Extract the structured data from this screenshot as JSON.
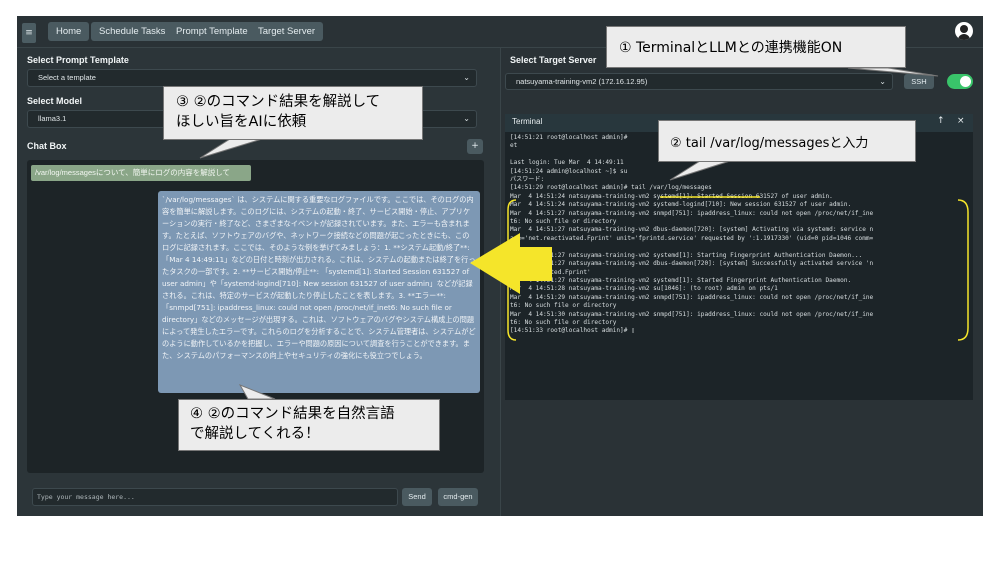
{
  "nav": {
    "menu_icon": "menu-icon",
    "items": [
      "Home",
      "Schedule Tasks",
      "Prompt Template",
      "Target Server"
    ],
    "avatar_icon": "user-avatar-icon"
  },
  "left": {
    "prompt_label": "Select Prompt Template",
    "prompt_value": "Select a template",
    "model_label": "Select Model",
    "model_value": "llama3.1",
    "chat_label": "Chat Box",
    "plus": "+",
    "user_message": "/var/log/messagesについて、簡単にログの内容を解説して",
    "bot_message": "`/var/log/messages` は、システムに関する重要なログファイルです。ここでは、そのログの内容を簡単に解説します。このログには、システムの起動・終了、サービス開始・停止、アプリケーションの実行・終了など、さまざまなイベントが記録されています。また、エラーも含まれます。たとえば、ソフトウェアのバグや、ネットワーク接続などの問題が起こったときにも、このログに記録されます。ここでは、そのような例を挙げてみましょう：1. **システム起動/終了**: 「Mar 4 14:49:11」などの日付と時刻が出力される。これは、システムの起動または終了を行ったタスクの一部です。2. **サービス開始/停止**: 「systemd[1]: Started Session 631527 of user admin」や「systemd-logind[710]: New session 631527 of user admin」などが記録される。これは、特定のサービスが起動したり停止したことを表します。3. **エラー**: 「snmpd[751]: ipaddress_linux: could not open /proc/net/if_inet6: No such file or directory」などのメッセージが出現する。これは、ソフトウェアのバグやシステム構成上の問題によって発生したエラーです。これらのログを分析することで、システム管理者は、システムがどのように動作しているかを把握し、エラーや問題の原因について調査を行うことができます。また、システムのパフォーマンスの向上やセキュリティの強化にも役立つでしょう。",
    "input_placeholder": "Type your message here...",
    "send": "Send",
    "cmd_gen": "cmd-gen"
  },
  "right": {
    "server_label": "Select Target Server",
    "server_value": "natsuyama-training-vm2 (172.16.12.95)",
    "ssh": "SSH",
    "toggle_on": true,
    "terminal_label": "Terminal",
    "terminal_lines": [
      "[14:51:21 root@localhost admin]#                                                          pit.sock",
      "et",
      "",
      "Last login: Tue Mar  4 14:49:11",
      "[14:51:24 admin@localhost ~]$ su",
      "パスワード:",
      "[14:51:29 root@localhost admin]# tail /var/log/messages",
      "Mar  4 14:51:24 natsuyama-training-vm2 systemd[1]: Started Session 631527 of user admin.",
      "Mar  4 14:51:24 natsuyama-training-vm2 systemd-logind[710]: New session 631527 of user admin.",
      "Mar  4 14:51:27 natsuyama-training-vm2 snmpd[751]: ipaddress_linux: could not open /proc/net/if_ine",
      "t6: No such file or directory",
      "Mar  4 14:51:27 natsuyama-training-vm2 dbus-daemon[720]: [system] Activating via systemd: service n",
      "ame='net.reactivated.Fprint' unit='fprintd.service' requested by ':1.1917330' (uid=0 pid=1046 comm=",
      "\"\")",
      "Mar  4 14:51:27 natsuyama-training-vm2 systemd[1]: Starting Fingerprint Authentication Daemon...",
      "Mar  4 14:51:27 natsuyama-training-vm2 dbus-daemon[720]: [system] Successfully activated service 'n",
      "et.reactivated.Fprint'",
      "Mar  4 14:51:27 natsuyama-training-vm2 systemd[1]: Started Fingerprint Authentication Daemon.",
      "Mar  4 14:51:28 natsuyama-training-vm2 su[1046]: (to root) admin on pts/1",
      "Mar  4 14:51:29 natsuyama-training-vm2 snmpd[751]: ipaddress_linux: could not open /proc/net/if_ine",
      "t6: No such file or directory",
      "Mar  4 14:51:30 natsuyama-training-vm2 snmpd[751]: ipaddress_linux: could not open /proc/net/if_ine",
      "t6: No such file or directory",
      "[14:51:33 root@localhost admin]# ▯"
    ]
  },
  "callouts": {
    "c1": "① TerminalとLLMとの連携機能ON",
    "c2": "② tail /var/log/messagesと入力",
    "c3_line1": "③ ②のコマンド結果を解説して",
    "c3_line2": "ほしい旨をAIに依頼",
    "c4_line1": "④ ②のコマンド結果を自然言語",
    "c4_line2": "で解説してくれる！"
  },
  "colors": {
    "highlight": "#f5e52a",
    "toggle_on": "#39c46a",
    "user_bubble": "#8aa688",
    "bot_bubble": "#7d98b4"
  }
}
